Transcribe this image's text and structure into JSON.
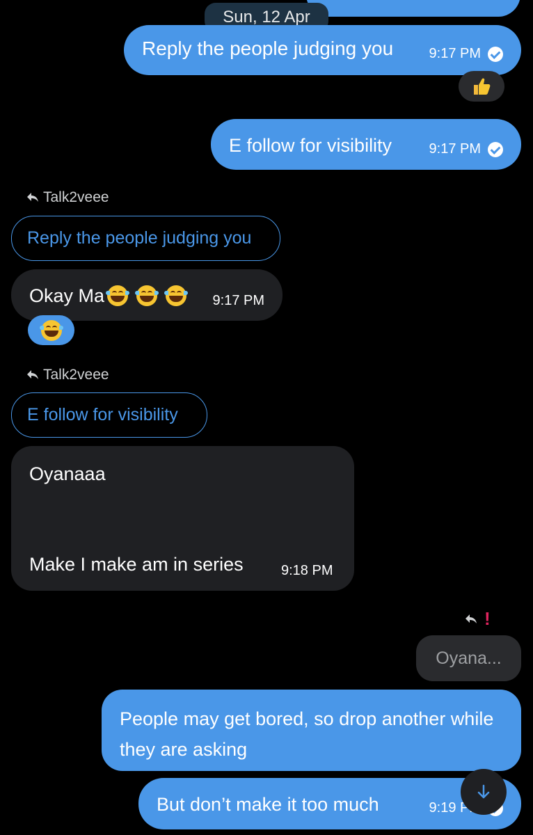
{
  "date_chip": "Sun, 12 Apr",
  "messages": {
    "m1": {
      "text": "Reply the people judging you",
      "time": "9:17 PM"
    },
    "m2": {
      "text": "E follow for visibility",
      "time": "9:17 PM"
    },
    "m3": {
      "reply_to": "Talk2veee",
      "quote": "Reply the people judging you",
      "text": "Okay Ma",
      "time": "9:17 PM"
    },
    "m4": {
      "reply_to": "Talk2veee",
      "quote": "E follow for visibility",
      "text_line1": "Oyanaaa",
      "text_line2": "Make I make am in series",
      "time": "9:18 PM"
    },
    "m5": {
      "quote": "Oyana...",
      "error_mark": "!"
    },
    "m6": {
      "text": "People may get bored, so drop another while they are asking"
    },
    "m7": {
      "text": "But don’t make it too much",
      "time": "9:19 PM"
    }
  },
  "reactions": {
    "r1": "thumbs-up-icon",
    "r2": "laughing-face-icon"
  },
  "colors": {
    "outgoing_bubble": "#4a97e8",
    "incoming_bubble": "#1f2023",
    "background": "#000000",
    "accent": "#4a97e8",
    "error": "#e0245e"
  }
}
